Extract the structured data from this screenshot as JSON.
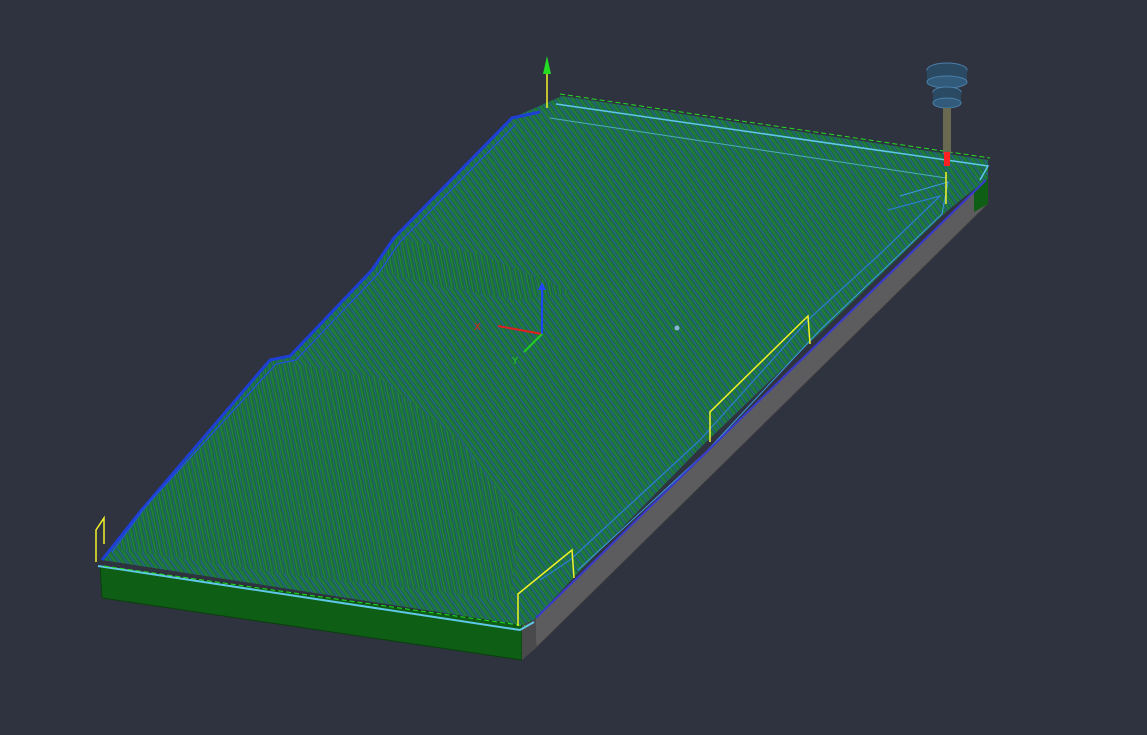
{
  "viewport": {
    "background": "#2f3340",
    "model": "toolpath-plate",
    "colors": {
      "toolpath_dark": "#1f7a2a",
      "toolpath_blue": "#2a5ea8",
      "toolpath_surface": "#1d6e54",
      "outline_blue": "#1e3fd6",
      "boundary_cyan": "#5fc8e8",
      "stock_front": "#0f5e16",
      "stock_side": "#5c5c5e",
      "leadin_yellow": "#f2f22a",
      "triad_x": "#e02020",
      "triad_y": "#22cc22",
      "triad_z": "#2244ff",
      "home_arrow": "#22dd22",
      "tool_holder": "#3a5f7a",
      "tool_tip": "#ff2222"
    }
  },
  "triad": {
    "x_label": "X",
    "y_label": "Y",
    "z_label": "Z"
  },
  "icons": {
    "tool": "cutting-tool-icon",
    "triad": "axis-triad-icon",
    "home": "home-origin-icon"
  }
}
